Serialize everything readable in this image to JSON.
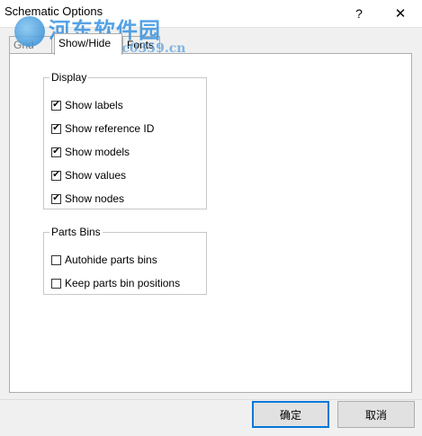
{
  "window": {
    "title": "Schematic Options",
    "help_label": "?",
    "close_label": "✕"
  },
  "watermark": {
    "cn_text": "河东软件园",
    "url": "www.pc0359.cn"
  },
  "tabs": [
    {
      "label": "Grid",
      "active": false
    },
    {
      "label": "Show/Hide",
      "active": true
    },
    {
      "label": "Fonts",
      "active": false
    }
  ],
  "display_group": {
    "legend": "Display",
    "items": [
      {
        "label": "Show labels",
        "checked": true
      },
      {
        "label": "Show reference ID",
        "checked": true
      },
      {
        "label": "Show models",
        "checked": true
      },
      {
        "label": "Show values",
        "checked": true
      },
      {
        "label": "Show nodes",
        "checked": true
      }
    ]
  },
  "bins_group": {
    "legend": "Parts Bins",
    "items": [
      {
        "label": "Autohide parts bins",
        "checked": false
      },
      {
        "label": "Keep parts bin positions",
        "checked": false
      }
    ]
  },
  "buttons": {
    "ok_label": "确定",
    "cancel_label": "取消"
  },
  "check_glyph": "✔"
}
